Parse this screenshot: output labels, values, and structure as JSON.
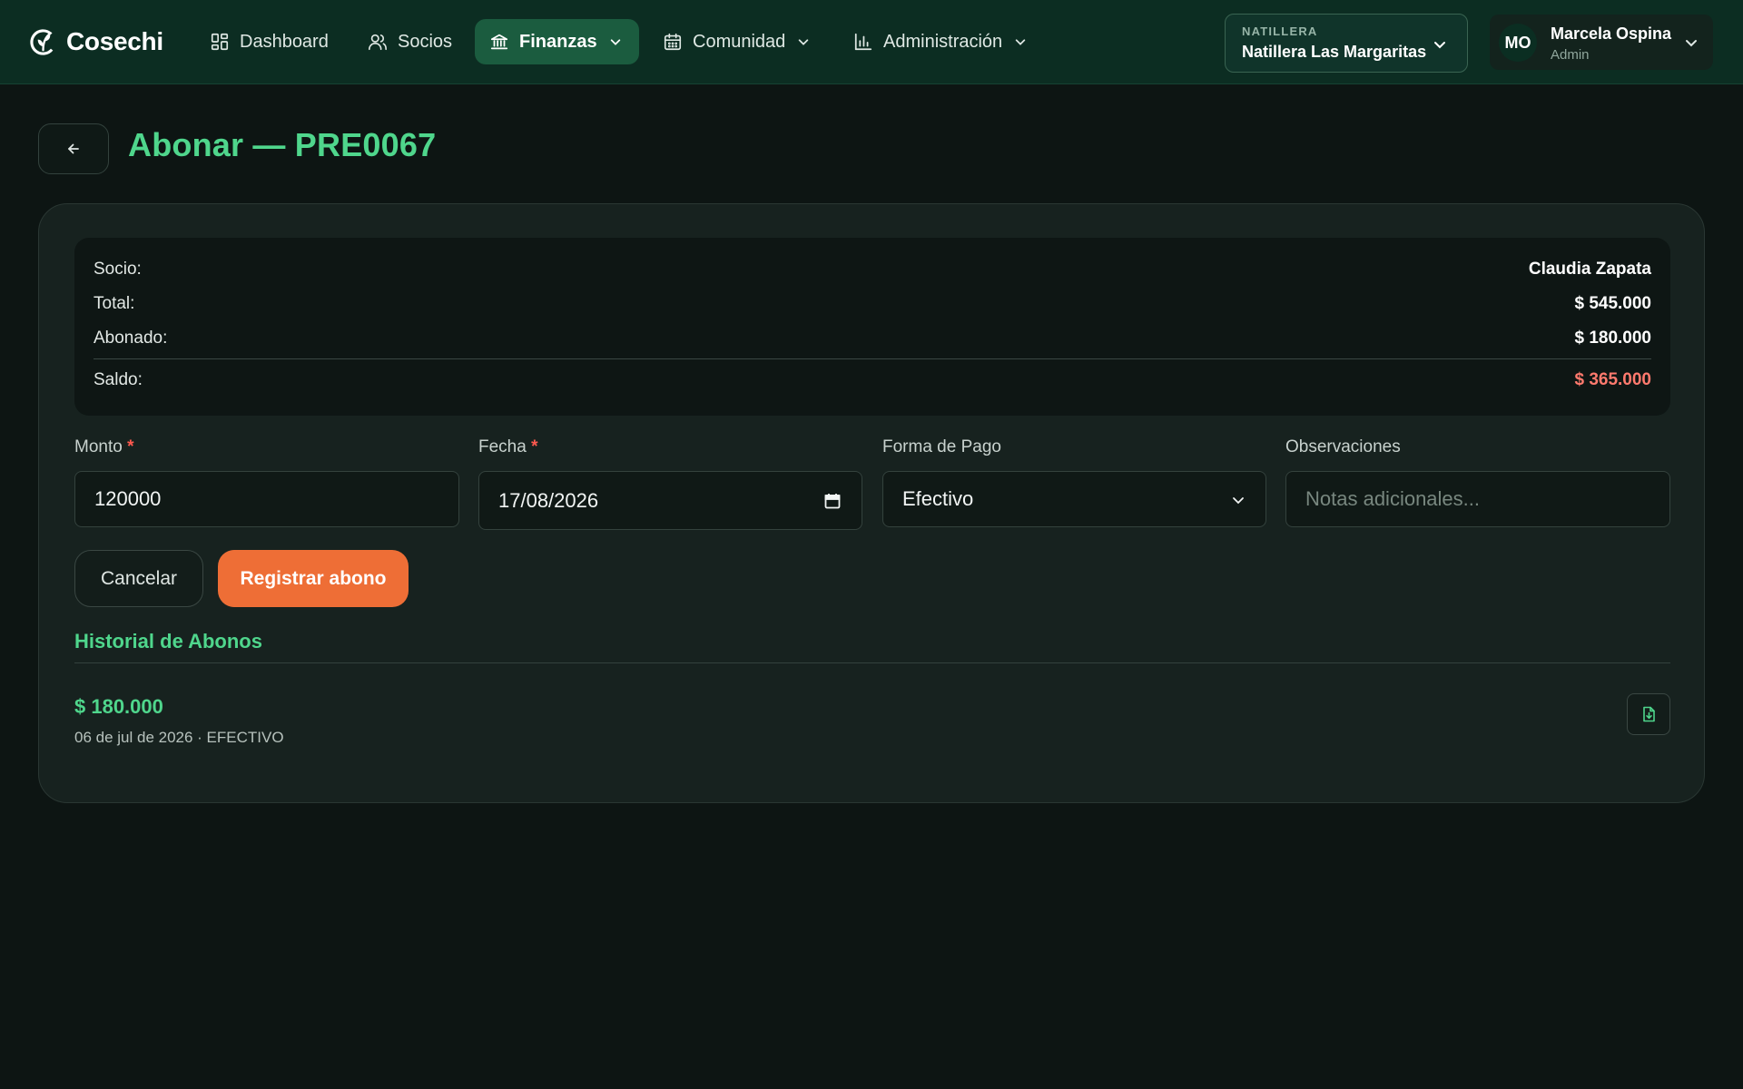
{
  "brand": {
    "name": "Cosechi"
  },
  "nav": [
    {
      "label": "Dashboard",
      "icon": "dashboard-icon"
    },
    {
      "label": "Socios",
      "icon": "users-icon"
    },
    {
      "label": "Finanzas",
      "icon": "bank-icon",
      "active": true
    },
    {
      "label": "Comunidad",
      "icon": "calendar-icon"
    },
    {
      "label": "Administración",
      "icon": "bar-chart-icon"
    }
  ],
  "org": {
    "label": "NATILLERA",
    "name": "Natillera Las Margaritas"
  },
  "user": {
    "initials": "MO",
    "name": "Marcela Ospina",
    "role": "Admin"
  },
  "page": {
    "title": "Abonar — PRE0067"
  },
  "summary": {
    "socio_label": "Socio:",
    "socio_value": "Claudia Zapata",
    "total_label": "Total:",
    "total_value": "$ 545.000",
    "abonado_label": "Abonado:",
    "abonado_value": "$ 180.000",
    "saldo_label": "Saldo:",
    "saldo_value": "$ 365.000"
  },
  "form": {
    "monto_label": "Monto",
    "monto_value": "120000",
    "fecha_label": "Fecha",
    "fecha_value": "17/08/2026",
    "forma_label": "Forma de Pago",
    "forma_value": "Efectivo",
    "obs_label": "Observaciones",
    "obs_placeholder": "Notas adicionales...",
    "required_mark": "*",
    "cancel_label": "Cancelar",
    "submit_label": "Registrar abono"
  },
  "history": {
    "title": "Historial de Abonos",
    "items": [
      {
        "amount": "$ 180.000",
        "meta": "06 de jul de 2026 · EFECTIVO"
      }
    ]
  },
  "colors": {
    "accent": "#4fd68c",
    "cta": "#ee6e36",
    "negative": "#ff7a6e",
    "nav_bg": "#0c2d22",
    "page_bg": "#0d1513",
    "card_bg": "#17221f"
  }
}
